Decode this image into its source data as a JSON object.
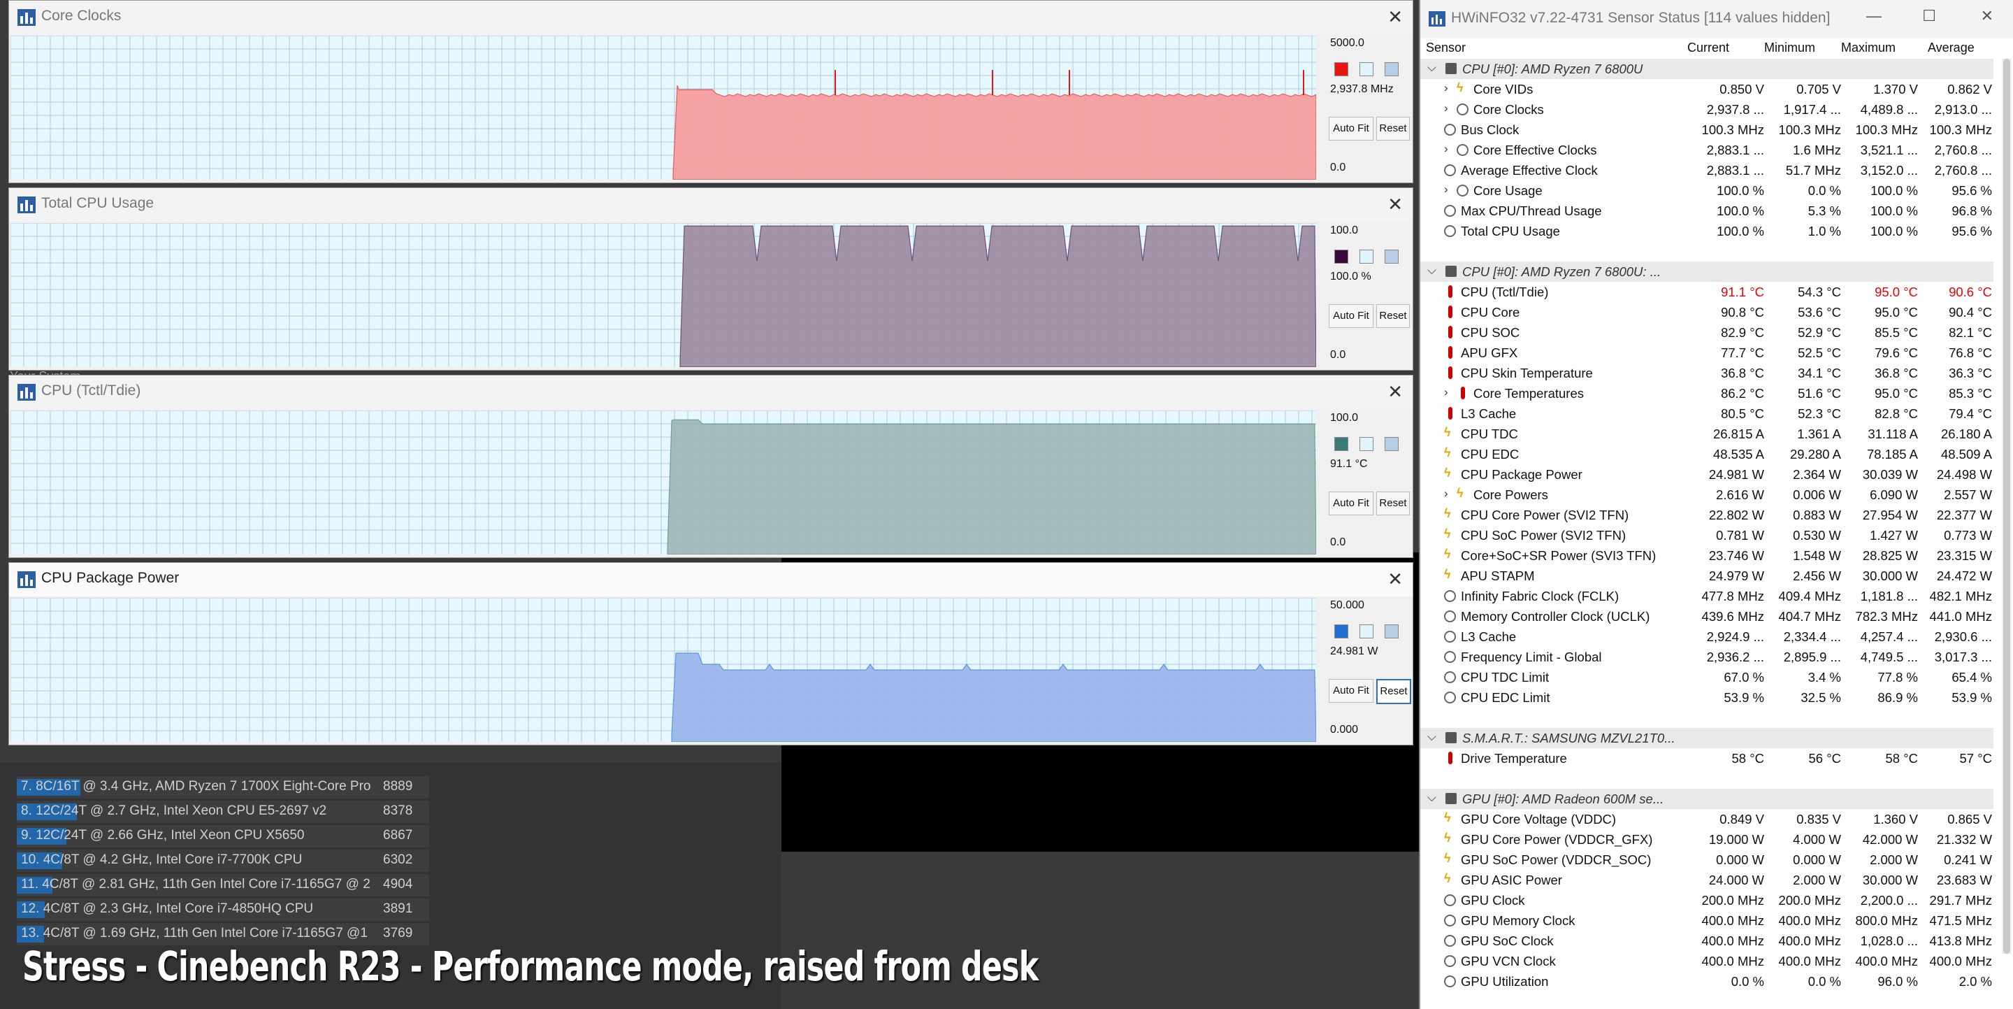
{
  "background": {
    "system_label": "Your System",
    "ranking": [
      {
        "label": "7. 8C/16T @ 3.4 GHz, AMD Ryzen 7 1700X Eight-Core Pro",
        "score": "8889",
        "bar": 0.155
      },
      {
        "label": "8. 12C/24T @ 2.7 GHz, Intel Xeon CPU E5-2697 v2",
        "score": "8378",
        "bar": 0.146
      },
      {
        "label": "9. 12C/24T @ 2.66 GHz, Intel Xeon CPU X5650",
        "score": "6867",
        "bar": 0.12
      },
      {
        "label": "10. 4C/8T @ 4.2 GHz, Intel Core i7-7700K CPU",
        "score": "6302",
        "bar": 0.11
      },
      {
        "label": "11. 4C/8T @ 2.81 GHz, 11th Gen Intel Core i7-1165G7 @ 2",
        "score": "4904",
        "bar": 0.086
      },
      {
        "label": "12. 4C/8T @ 2.3 GHz, Intel Core i7-4850HQ CPU",
        "score": "3891",
        "bar": 0.068
      },
      {
        "label": "13. 4C/8T @ 1.69 GHz, 11th Gen Intel Core i7-1165G7 @1",
        "score": "3769",
        "bar": 0.066
      }
    ],
    "caption": "Stress - Cinebench R23 - Performance mode, raised from desk"
  },
  "graphs": [
    {
      "title": "Core Clocks",
      "max": "5000.0",
      "current": "2,937.8 MHz",
      "min": "0.0",
      "color": "#f69a9a",
      "swatch": "#e81515",
      "level": 0.587,
      "auto_fit": "Auto Fit",
      "reset": "Reset"
    },
    {
      "title": "Total CPU Usage",
      "max": "100.0",
      "current": "100.0 %",
      "min": "0.0",
      "color": "#9c8aa2",
      "swatch": "#3a0a3a",
      "level": 0.98,
      "auto_fit": "Auto Fit",
      "reset": "Reset"
    },
    {
      "title": "CPU (Tctl/Tdie)",
      "max": "100.0",
      "current": "91.1 °C",
      "min": "0.0",
      "color": "#9fb6b6",
      "swatch": "#3b7a78",
      "level": 0.911,
      "auto_fit": "Auto Fit",
      "reset": "Reset"
    },
    {
      "title": "CPU Package Power",
      "max": "50.000",
      "current": "24.981 W",
      "min": "0.000",
      "color": "#9bb4ec",
      "swatch": "#1f6fd1",
      "level": 0.5,
      "auto_fit": "Auto Fit",
      "reset": "Reset"
    }
  ],
  "hwinfo": {
    "title": "HWiNFO32 v7.22-4731 Sensor Status [114 values hidden]",
    "columns": [
      "Sensor",
      "Current",
      "Minimum",
      "Maximum",
      "Average"
    ],
    "rows": [
      {
        "type": "sec",
        "name": "CPU [#0]: AMD Ryzen 7 6800U"
      },
      {
        "name": "Core VIDs",
        "icon": "bolt",
        "exp": true,
        "v": [
          "0.850 V",
          "0.705 V",
          "1.370 V",
          "0.862 V"
        ]
      },
      {
        "name": "Core Clocks",
        "icon": "clock",
        "exp": true,
        "v": [
          "2,937.8 ...",
          "1,917.4 ...",
          "4,489.8 ...",
          "2,913.0 ..."
        ]
      },
      {
        "name": "Bus Clock",
        "icon": "clock",
        "v": [
          "100.3 MHz",
          "100.3 MHz",
          "100.3 MHz",
          "100.3 MHz"
        ]
      },
      {
        "name": "Core Effective Clocks",
        "icon": "clock",
        "exp": true,
        "v": [
          "2,883.1 ...",
          "1.6 MHz",
          "3,521.1 ...",
          "2,760.8 ..."
        ]
      },
      {
        "name": "Average Effective Clock",
        "icon": "clock",
        "v": [
          "2,883.1 ...",
          "51.7 MHz",
          "3,152.0 ...",
          "2,760.8 ..."
        ]
      },
      {
        "name": "Core Usage",
        "icon": "clock",
        "exp": true,
        "v": [
          "100.0 %",
          "0.0 %",
          "100.0 %",
          "95.6 %"
        ]
      },
      {
        "name": "Max CPU/Thread Usage",
        "icon": "clock",
        "v": [
          "100.0 %",
          "5.3 %",
          "100.0 %",
          "96.8 %"
        ]
      },
      {
        "name": "Total CPU Usage",
        "icon": "clock",
        "v": [
          "100.0 %",
          "1.0 %",
          "100.0 %",
          "95.6 %"
        ]
      },
      {
        "type": "blank"
      },
      {
        "type": "sec",
        "name": "CPU [#0]: AMD Ryzen 7 6800U: ..."
      },
      {
        "name": "CPU (Tctl/Tdie)",
        "icon": "therm",
        "hot": true,
        "v": [
          "91.1 °C",
          "54.3 °C",
          "95.0 °C",
          "90.6 °C"
        ]
      },
      {
        "name": "CPU Core",
        "icon": "therm",
        "v": [
          "90.8 °C",
          "53.6 °C",
          "95.0 °C",
          "90.4 °C"
        ]
      },
      {
        "name": "CPU SOC",
        "icon": "therm",
        "v": [
          "82.9 °C",
          "52.9 °C",
          "85.5 °C",
          "82.1 °C"
        ]
      },
      {
        "name": "APU GFX",
        "icon": "therm",
        "v": [
          "77.7 °C",
          "52.5 °C",
          "79.6 °C",
          "76.8 °C"
        ]
      },
      {
        "name": "CPU Skin Temperature",
        "icon": "therm",
        "v": [
          "36.8 °C",
          "34.1 °C",
          "36.8 °C",
          "36.3 °C"
        ]
      },
      {
        "name": "Core Temperatures",
        "icon": "therm",
        "exp": true,
        "v": [
          "86.2 °C",
          "51.6 °C",
          "95.0 °C",
          "85.3 °C"
        ]
      },
      {
        "name": "L3 Cache",
        "icon": "therm",
        "v": [
          "80.5 °C",
          "52.3 °C",
          "82.8 °C",
          "79.4 °C"
        ]
      },
      {
        "name": "CPU TDC",
        "icon": "bolt",
        "v": [
          "26.815 A",
          "1.361 A",
          "31.118 A",
          "26.180 A"
        ]
      },
      {
        "name": "CPU EDC",
        "icon": "bolt",
        "v": [
          "48.535 A",
          "29.280 A",
          "78.185 A",
          "48.509 A"
        ]
      },
      {
        "name": "CPU Package Power",
        "icon": "bolt",
        "v": [
          "24.981 W",
          "2.364 W",
          "30.039 W",
          "24.498 W"
        ]
      },
      {
        "name": "Core Powers",
        "icon": "bolt",
        "exp": true,
        "v": [
          "2.616 W",
          "0.006 W",
          "6.090 W",
          "2.557 W"
        ]
      },
      {
        "name": "CPU Core Power (SVI2 TFN)",
        "icon": "bolt",
        "v": [
          "22.802 W",
          "0.883 W",
          "27.954 W",
          "22.377 W"
        ]
      },
      {
        "name": "CPU SoC Power (SVI2 TFN)",
        "icon": "bolt",
        "v": [
          "0.781 W",
          "0.530 W",
          "1.427 W",
          "0.773 W"
        ]
      },
      {
        "name": "Core+SoC+SR Power (SVI3 TFN)",
        "icon": "bolt",
        "v": [
          "23.746 W",
          "1.548 W",
          "28.825 W",
          "23.315 W"
        ]
      },
      {
        "name": "APU STAPM",
        "icon": "bolt",
        "v": [
          "24.979 W",
          "2.456 W",
          "30.000 W",
          "24.472 W"
        ]
      },
      {
        "name": "Infinity Fabric Clock (FCLK)",
        "icon": "clock",
        "v": [
          "477.8 MHz",
          "409.4 MHz",
          "1,181.8 ...",
          "482.1 MHz"
        ]
      },
      {
        "name": "Memory Controller Clock (UCLK)",
        "icon": "clock",
        "v": [
          "439.6 MHz",
          "404.7 MHz",
          "782.3 MHz",
          "441.0 MHz"
        ]
      },
      {
        "name": "L3 Cache",
        "icon": "clock",
        "v": [
          "2,924.9 ...",
          "2,334.4 ...",
          "4,257.4 ...",
          "2,930.6 ..."
        ]
      },
      {
        "name": "Frequency Limit - Global",
        "icon": "clock",
        "v": [
          "2,936.2 ...",
          "2,895.9 ...",
          "4,749.5 ...",
          "3,017.3 ..."
        ]
      },
      {
        "name": "CPU TDC Limit",
        "icon": "clock",
        "v": [
          "67.0 %",
          "3.4 %",
          "77.8 %",
          "65.4 %"
        ]
      },
      {
        "name": "CPU EDC Limit",
        "icon": "clock",
        "v": [
          "53.9 %",
          "32.5 %",
          "86.9 %",
          "53.9 %"
        ]
      },
      {
        "type": "blank"
      },
      {
        "type": "sec",
        "name": "S.M.A.R.T.: SAMSUNG MZVL21T0..."
      },
      {
        "name": "Drive Temperature",
        "icon": "therm",
        "v": [
          "58 °C",
          "56 °C",
          "58 °C",
          "57 °C"
        ]
      },
      {
        "type": "blank"
      },
      {
        "type": "sec",
        "name": "GPU [#0]: AMD Radeon 600M se..."
      },
      {
        "name": "GPU Core Voltage (VDDC)",
        "icon": "bolt",
        "v": [
          "0.849 V",
          "0.835 V",
          "1.360 V",
          "0.865 V"
        ]
      },
      {
        "name": "GPU Core Power (VDDCR_GFX)",
        "icon": "bolt",
        "v": [
          "19.000 W",
          "4.000 W",
          "42.000 W",
          "21.332 W"
        ]
      },
      {
        "name": "GPU SoC Power (VDDCR_SOC)",
        "icon": "bolt",
        "v": [
          "0.000 W",
          "0.000 W",
          "2.000 W",
          "0.241 W"
        ]
      },
      {
        "name": "GPU ASIC Power",
        "icon": "bolt",
        "v": [
          "24.000 W",
          "2.000 W",
          "30.000 W",
          "23.683 W"
        ]
      },
      {
        "name": "GPU Clock",
        "icon": "clock",
        "v": [
          "200.0 MHz",
          "200.0 MHz",
          "2,200.0 ...",
          "291.7 MHz"
        ]
      },
      {
        "name": "GPU Memory Clock",
        "icon": "clock",
        "v": [
          "400.0 MHz",
          "400.0 MHz",
          "800.0 MHz",
          "471.5 MHz"
        ]
      },
      {
        "name": "GPU SoC Clock",
        "icon": "clock",
        "v": [
          "400.0 MHz",
          "400.0 MHz",
          "1,028.0 ...",
          "413.8 MHz"
        ]
      },
      {
        "name": "GPU VCN Clock",
        "icon": "clock",
        "v": [
          "400.0 MHz",
          "400.0 MHz",
          "400.0 MHz",
          "400.0 MHz"
        ]
      },
      {
        "name": "GPU Utilization",
        "icon": "clock",
        "v": [
          "0.0 %",
          "0.0 %",
          "96.0 %",
          "2.0 %"
        ]
      }
    ]
  }
}
